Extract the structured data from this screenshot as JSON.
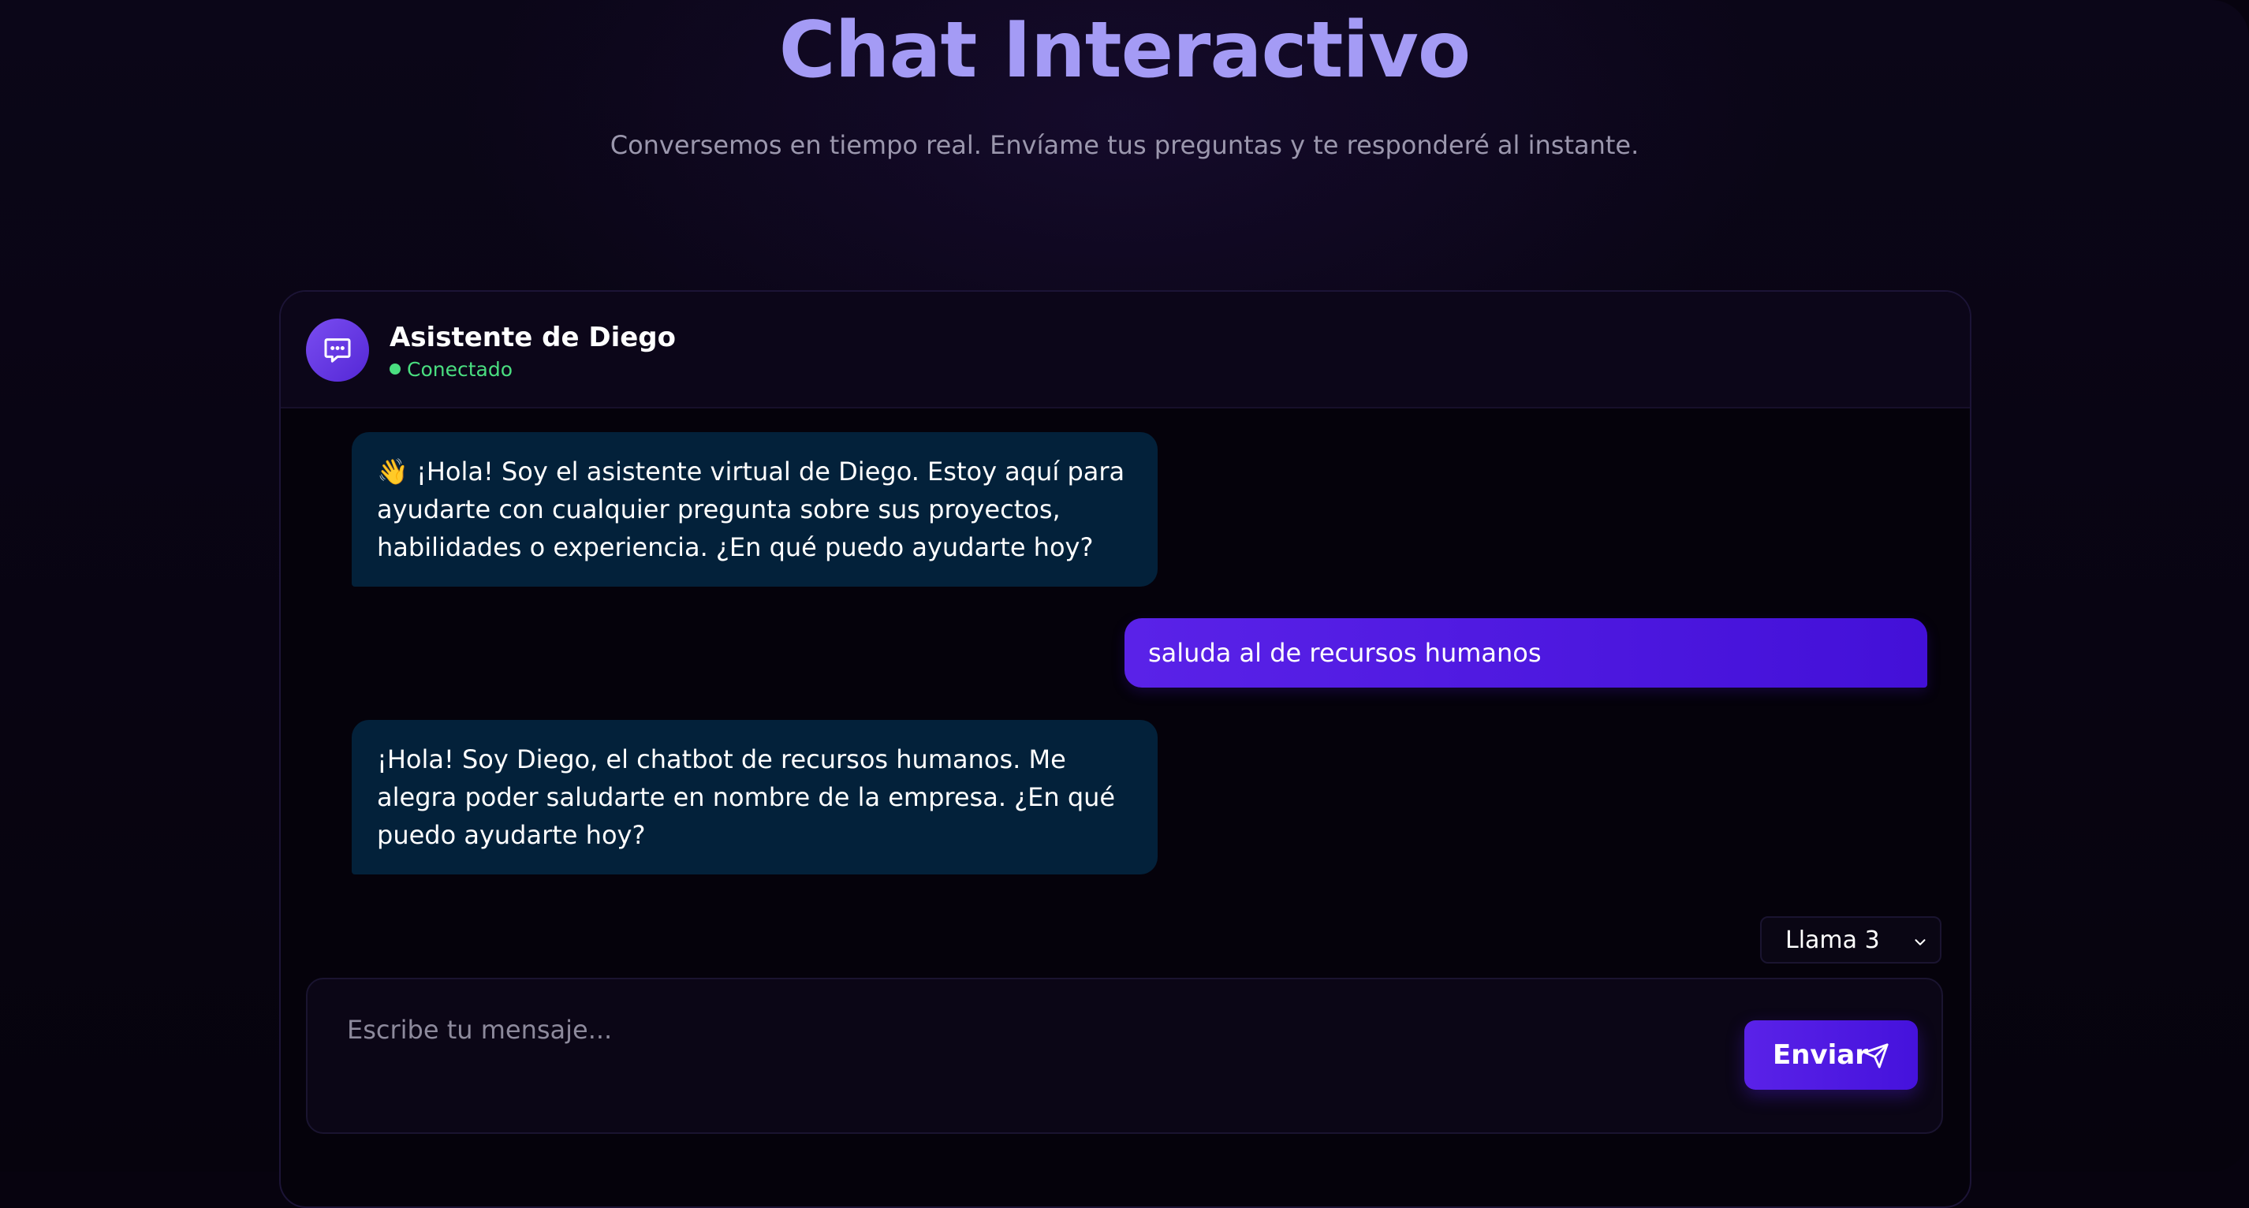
{
  "hero": {
    "title": "Chat Interactivo",
    "subtitle": "Conversemos en tiempo real. Envíame tus preguntas y te responderé al instante."
  },
  "chat": {
    "assistant_name": "Asistente de Diego",
    "status": "Conectado",
    "avatar_icon": "chat-bubble-icon",
    "messages": [
      {
        "role": "assistant",
        "text": "👋 ¡Hola! Soy el asistente virtual de Diego. Estoy aquí para ayudarte con cualquier pregunta sobre sus proyectos, habilidades o experiencia. ¿En qué puedo ayudarte hoy?"
      },
      {
        "role": "user",
        "text": "saluda al de recursos humanos"
      },
      {
        "role": "assistant",
        "text": "¡Hola! Soy Diego, el chatbot de recursos humanos. Me alegra poder saludarte en nombre de la empresa. ¿En qué puedo ayudarte hoy?"
      }
    ]
  },
  "model_selector": {
    "selected": "Llama 3",
    "icon": "chevron-down-icon"
  },
  "composer": {
    "placeholder": "Escribe tu mensaje...",
    "value": "",
    "send_label": "Enviar",
    "send_icon": "send-icon"
  },
  "colors": {
    "background": "#07030f",
    "title_accent": "#a49bf5",
    "status_green": "#4ade80",
    "bot_bubble": "#03213a",
    "user_bubble": "#5a22e8",
    "send_button": "#4f1ae2"
  }
}
